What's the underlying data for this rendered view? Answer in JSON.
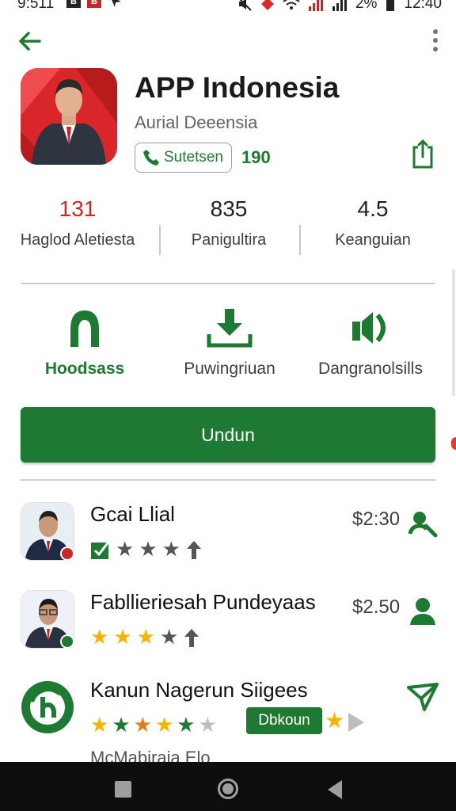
{
  "status_bar": {
    "time": "9:511",
    "left_badges": [
      "B",
      "B"
    ],
    "battery_text": "2%",
    "clock_right": "12:40"
  },
  "app": {
    "title": "APP Indonesia",
    "developer": "Aurial Deeensia",
    "chip_label": "Sutetsen",
    "chip_count": "190",
    "accent_color": "#1e7a33"
  },
  "stats": [
    {
      "value": "131",
      "label": "Haglod Aletiesta",
      "color": "#c62828"
    },
    {
      "value": "835",
      "label": "Panigultira",
      "color": "#3c4043"
    },
    {
      "value": "4.5",
      "label": "Keanguian",
      "color": "#3c4043"
    }
  ],
  "actions": [
    {
      "label": "Hoodsass",
      "icon": "lock-icon",
      "active": true
    },
    {
      "label": "Puwingriuan",
      "icon": "download-icon",
      "active": false
    },
    {
      "label": "Dangranolsills",
      "icon": "audio-icon",
      "active": false
    }
  ],
  "install_button": {
    "label": "Undun"
  },
  "reviews": [
    {
      "name": "Gcai Llial",
      "price": "$2:30",
      "icon": "user-search-icon"
    },
    {
      "name": "Fabllieriesah Pundeyaas",
      "price": "$2.50",
      "icon": "user-icon"
    },
    {
      "name": "Kanun Nagerun Siigees",
      "chip": "Dbkoun",
      "icon": "send-icon"
    }
  ],
  "cut_text": "McMabiraia Elo"
}
